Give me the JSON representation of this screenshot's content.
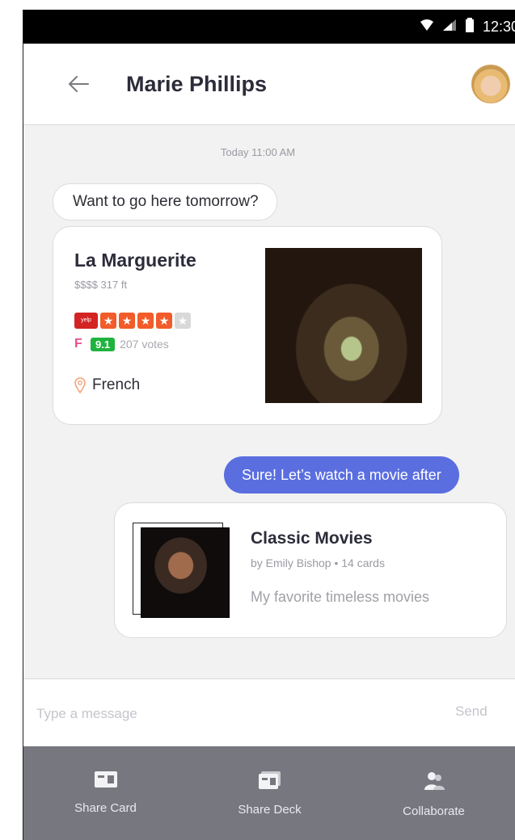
{
  "status_bar": {
    "time": "12:30"
  },
  "header": {
    "title": "Marie Phillips"
  },
  "chat": {
    "timestamp": "Today 11:00 AM",
    "incoming_message": "Want to go here tomorrow?",
    "place_card": {
      "name": "La Marguerite",
      "price_distance": "$$$$  317 ft",
      "yelp_rating_stars": 4,
      "yelp_rating_max": 5,
      "yelp_logo_text": "yelp",
      "foursquare_score": "9.1",
      "votes": "207 votes",
      "category": "French"
    },
    "outgoing_message": "Sure! Let’s watch a movie after",
    "deck_card": {
      "title": "Classic Movies",
      "meta": "by Emily Bishop • 14 cards",
      "description": "My favorite timeless movies"
    }
  },
  "composer": {
    "placeholder": "Type a message",
    "send_label": "Send"
  },
  "bottom_bar": {
    "items": [
      {
        "label": "Share Card",
        "icon": "share-card-icon"
      },
      {
        "label": "Share Deck",
        "icon": "share-deck-icon"
      },
      {
        "label": "Collaborate",
        "icon": "collaborate-icon"
      }
    ]
  },
  "colors": {
    "accent": "#5a6ee0",
    "bottom_bar": "#77787f",
    "yelp": "#d32323",
    "foursquare_score": "#1fb33e"
  }
}
